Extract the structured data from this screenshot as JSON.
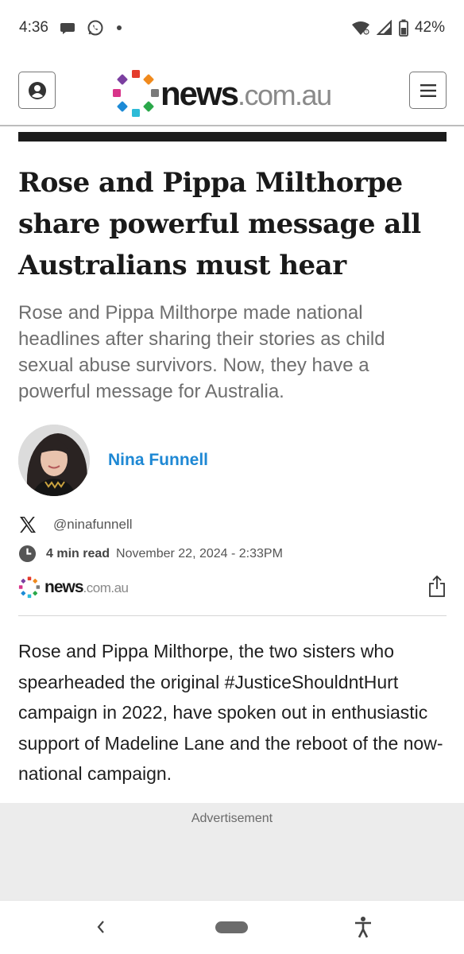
{
  "status_bar": {
    "time": "4:36",
    "battery": "42%",
    "icons": [
      "chat-icon",
      "whatsapp-icon",
      "dot-icon",
      "wifi-icon",
      "signal-icon",
      "battery-icon"
    ]
  },
  "header": {
    "logo": {
      "word_bold": "news",
      "word_domain": ".com.au"
    },
    "account_icon": "account-icon",
    "menu_icon": "hamburger-icon"
  },
  "article": {
    "headline": "Rose and Pippa Milthorpe share powerful message all Australians must hear",
    "standfirst": "Rose and Pippa Milthorpe made national headlines after sharing their stories as child sexual abuse survivors. Now, they have a powerful message for Australia.",
    "author": {
      "name": "Nina Funnell",
      "twitter": "@ninafunnell"
    },
    "read_time": "4 min read",
    "published": "November 22, 2024 - 2:33PM",
    "source": {
      "word_bold": "news",
      "word_domain": ".com.au"
    },
    "body": "Rose and Pippa Milthorpe, the two sisters who spearheaded the original #JusticeShouldntHurt campaign in 2022, have spoken out in enthusiastic support of Madeline Lane and the reboot of the now-national campaign."
  },
  "advertisement": {
    "label": "Advertisement"
  },
  "colors": {
    "author_link": "#1e88d4",
    "black_bar": "#1c1c1c",
    "standfirst": "#6e6e6e",
    "logo_dots": [
      "#e43b2c",
      "#f08a1d",
      "#7a7a7a",
      "#2aa84a",
      "#1c8ad6",
      "#2dbbd7",
      "#7b3fa0",
      "#d8348a"
    ]
  }
}
